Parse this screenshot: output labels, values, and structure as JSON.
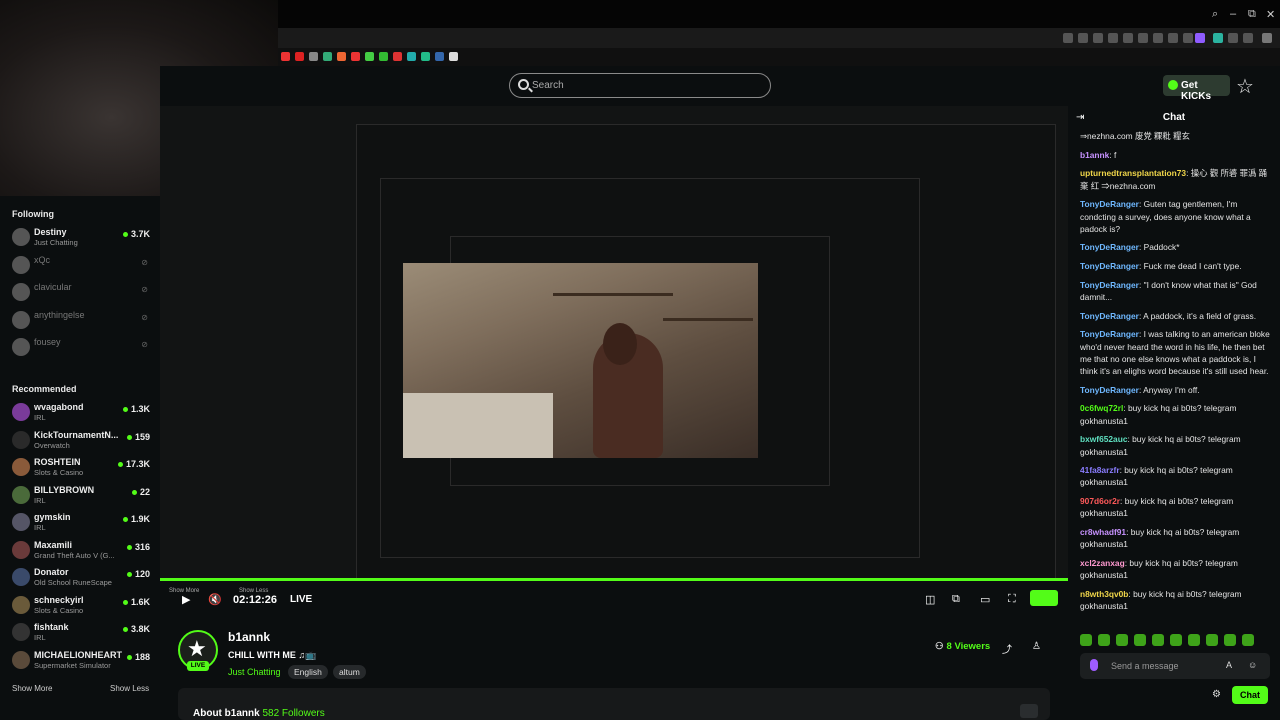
{
  "browser": {
    "window_controls": [
      "⌕",
      "–",
      "⧉",
      "✕"
    ]
  },
  "header": {
    "search_placeholder": "Search",
    "get_kicks_label": "Get KICKs",
    "star_icon": "☆"
  },
  "sidebar": {
    "following_title": "Following",
    "following": [
      {
        "name": "Destiny",
        "category": "Just Chatting",
        "viewers": "3.7K",
        "online": true
      },
      {
        "name": "xQc",
        "category": "",
        "viewers": "",
        "online": false
      },
      {
        "name": "clavicular",
        "category": "",
        "viewers": "",
        "online": false
      },
      {
        "name": "anythingelse",
        "category": "",
        "viewers": "",
        "online": false
      },
      {
        "name": "fousey",
        "category": "",
        "viewers": "",
        "online": false
      }
    ],
    "recommended_title": "Recommended",
    "recommended": [
      {
        "name": "wvagabond",
        "category": "IRL",
        "viewers": "1.3K"
      },
      {
        "name": "KickTournamentN...",
        "category": "Overwatch",
        "viewers": "159"
      },
      {
        "name": "ROSHTEIN",
        "category": "Slots & Casino",
        "viewers": "17.3K"
      },
      {
        "name": "BILLYBROWN",
        "category": "IRL",
        "viewers": "22"
      },
      {
        "name": "gymskin",
        "category": "IRL",
        "viewers": "1.9K"
      },
      {
        "name": "Maxamili",
        "category": "Grand Theft Auto V (G...",
        "viewers": "316"
      },
      {
        "name": "Donator",
        "category": "Old School RuneScape",
        "viewers": "120"
      },
      {
        "name": "schneckyirl",
        "category": "Slots & Casino",
        "viewers": "1.6K"
      },
      {
        "name": "fishtank",
        "category": "IRL",
        "viewers": "3.8K"
      },
      {
        "name": "MICHAELIONHEART",
        "category": "Supermarket Simulator",
        "viewers": "188"
      }
    ],
    "show_more": "Show More",
    "show_less": "Show Less"
  },
  "player": {
    "time": "02:12:26",
    "live_label": "LIVE",
    "show_more": "Show More",
    "show_less": "Show Less",
    "progress": 1.0
  },
  "stream": {
    "streamer": "b1annk",
    "title": "CHILL WITH ME ♫📺",
    "category": "Just Chatting",
    "tags": [
      "English",
      "altum"
    ],
    "live_badge": "LIVE",
    "viewers": "8 Viewers",
    "about_label": "About b1annk",
    "followers": "582 Followers"
  },
  "chat": {
    "title": "Chat",
    "messages": [
      {
        "user": "",
        "text": "⇒nezhna.com 废党 粿粃 糧玄",
        "color": "#e4e4e4"
      },
      {
        "user": "b1annk",
        "text": "f",
        "color": "#c792ff"
      },
      {
        "user": "upturnedtransplantation73",
        "text": "操心 觀 所碆 罪潙 踊 棄 红 ⇒nezhna.com",
        "color": "#f0d64a"
      },
      {
        "user": "TonyDeRanger",
        "text": "Guten tag gentlemen, I'm condcting a survey, does anyone know what a padock is?",
        "color": "#6fb8ff"
      },
      {
        "user": "TonyDeRanger",
        "text": "Paddock*",
        "color": "#6fb8ff"
      },
      {
        "user": "TonyDeRanger",
        "text": "Fuck me dead I can't type.",
        "color": "#6fb8ff"
      },
      {
        "user": "TonyDeRanger",
        "text": "\"I don't know what that is\" God damnit...",
        "color": "#6fb8ff"
      },
      {
        "user": "TonyDeRanger",
        "text": "A paddock, it's a field of grass.",
        "color": "#6fb8ff"
      },
      {
        "user": "TonyDeRanger",
        "text": "I was talking to an american bloke who'd never heard the word in his life, he then bet me that no one else knows what a paddock is, I think it's an elighs word because it's still used hear.",
        "color": "#6fb8ff"
      },
      {
        "user": "TonyDeRanger",
        "text": "Anyway I'm off.",
        "color": "#6fb8ff"
      },
      {
        "user": "0c6fwq72rl",
        "text": "buy kick hq ai b0ts? telegram gokhanusta1",
        "color": "#53fc18"
      },
      {
        "user": "bxwf652auc",
        "text": "buy kick hq ai b0ts? telegram gokhanusta1",
        "color": "#5fe0c0"
      },
      {
        "user": "41fa8arzfr",
        "text": "buy kick hq ai b0ts? telegram gokhanusta1",
        "color": "#8a7dff"
      },
      {
        "user": "907d6or2r",
        "text": "buy kick hq ai b0ts? telegram gokhanusta1",
        "color": "#ff5a5a"
      },
      {
        "user": "cr8whadf91",
        "text": "buy kick hq ai b0ts? telegram gokhanusta1",
        "color": "#c792ff"
      },
      {
        "user": "xcl2zanxag",
        "text": "buy kick hq ai b0ts? telegram gokhanusta1",
        "color": "#ff9ad0"
      },
      {
        "user": "n8wth3qv0b",
        "text": "buy kick hq ai b0ts? telegram gokhanusta1",
        "color": "#f0d64a"
      }
    ],
    "send_placeholder": "Send a message",
    "chat_button": "Chat"
  },
  "colors": {
    "accent": "#53fc18",
    "background": "#0b0e0f"
  }
}
